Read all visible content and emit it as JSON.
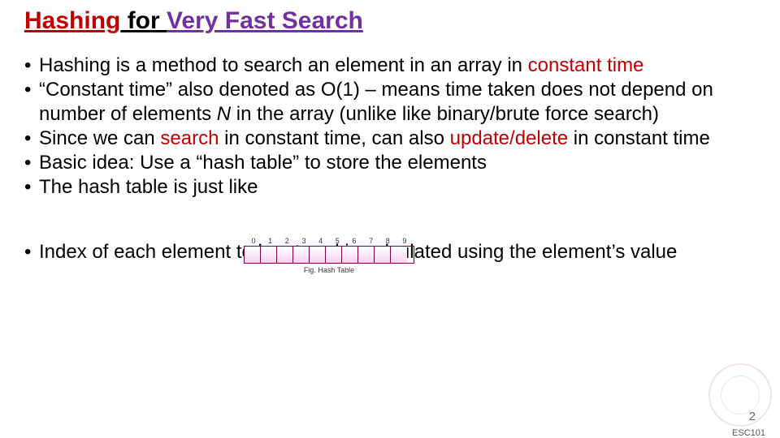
{
  "title": {
    "w1": "Hashing",
    "w2": " for ",
    "w3": "Very Fast Search"
  },
  "bullets": {
    "b1a": "Hashing is a method to search an element in an array in ",
    "b1b": "constant time",
    "b2a": "“Constant time” also denoted as O(1) – means time taken does not depend on number of elements ",
    "b2n": "N",
    "b2b": " in the array (unlike like binary/brute force search)",
    "b3a": "Since we can ",
    "b3b": "search",
    "b3c": " in constant time, can also ",
    "b3d": "update/delete",
    "b3e": " in constant time",
    "b4": "Basic idea: Use a “hash table” to store the elements",
    "b5": "The hash table is just like",
    "b6": "Index of each element to be stored is calculated using the element’s value"
  },
  "hash": {
    "n0": "0",
    "n1": "1",
    "n2": "2",
    "n3": "3",
    "n4": "4",
    "n5": "5",
    "n6": "6",
    "n7": "7",
    "n8": "8",
    "n9": "9",
    "caption": "Fig. Hash Table"
  },
  "footer": {
    "page": "2",
    "course": "ESC101"
  }
}
